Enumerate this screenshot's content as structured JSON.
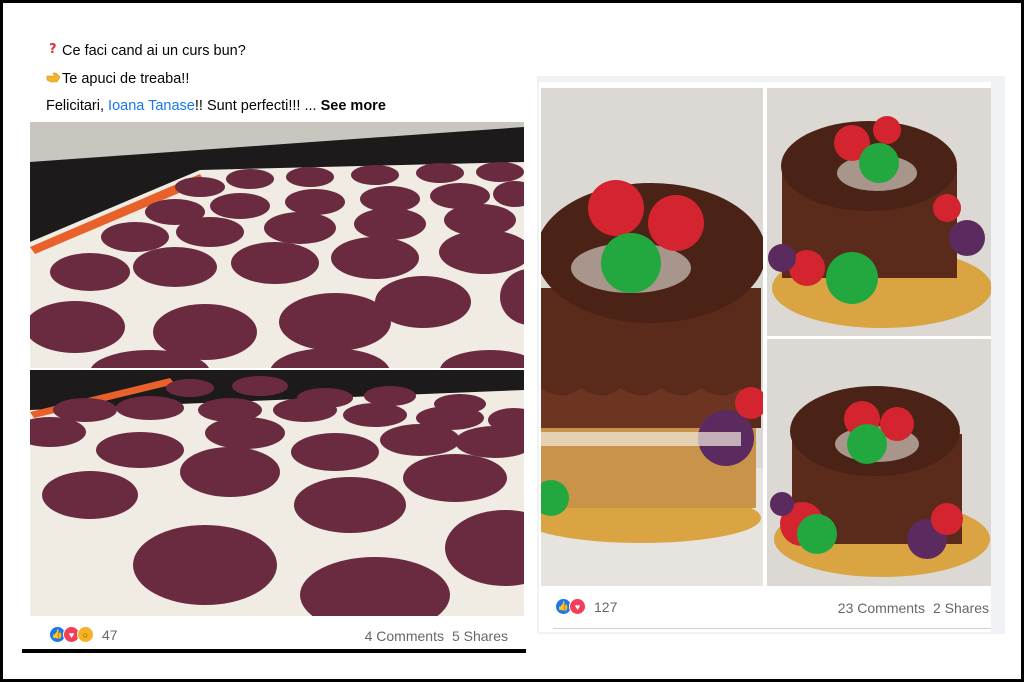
{
  "left_post": {
    "line1": "Ce faci cand ai un curs bun?",
    "line2": "Te apuci de treaba!!",
    "line3_before": "Felicitari, ",
    "mention": "Ioana Tanase",
    "line3_after": "!! Sunt perfecti!!! ... ",
    "see_more": "See more",
    "line1_icon": "question-mark-icon",
    "line2_icon": "pointing-hand-icon",
    "reaction_icons": [
      "like-icon",
      "love-icon",
      "wow-icon"
    ],
    "reaction_count": "47",
    "comments": "4 Comments",
    "shares": "5 Shares"
  },
  "right_post": {
    "reaction_icons": [
      "like-icon",
      "love-icon"
    ],
    "reaction_count": "127",
    "comments": "23 Comments",
    "shares": "2 Shares"
  },
  "colors": {
    "mention": "#1877f2",
    "macaron_shell": "#6a2a3f",
    "chocolate": "#5a2a1b",
    "macaron_red": "#d4242f",
    "macaron_green": "#22a83f",
    "macaron_purple": "#5b2a5f"
  }
}
